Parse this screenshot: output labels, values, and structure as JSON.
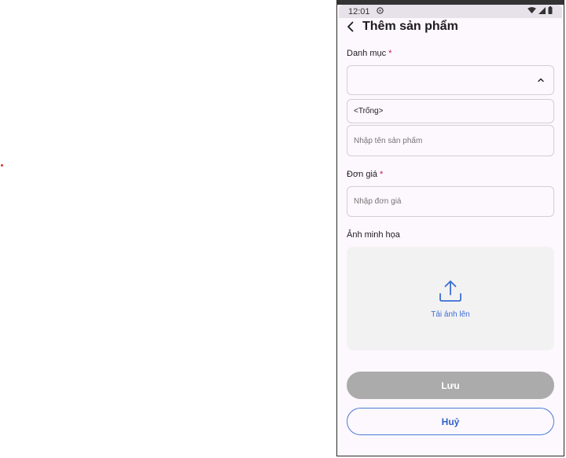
{
  "status_bar": {
    "time": "12:01"
  },
  "header": {
    "title": "Thêm sản phẩm"
  },
  "form": {
    "category": {
      "label": "Danh mục",
      "required_mark": "*",
      "value": "",
      "open_option": "<Trống>"
    },
    "product_name": {
      "placeholder": "Nhập tên sản phẩm"
    },
    "price": {
      "label": "Đơn giá",
      "required_mark": "*",
      "placeholder": "Nhập đơn giá"
    },
    "image": {
      "label": "Ảnh minh họa",
      "upload_label": "Tải ảnh lên"
    }
  },
  "buttons": {
    "save": "Lưu",
    "cancel": "Huỷ"
  },
  "colors": {
    "accent": "#3b6ed1",
    "required": "#c2185b",
    "disabled_button": "#ababab"
  }
}
